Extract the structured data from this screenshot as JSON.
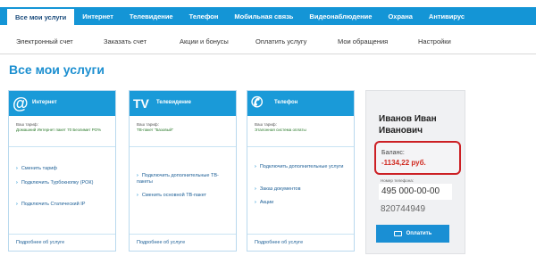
{
  "top_nav": [
    "Все мои услуги",
    "Интернет",
    "Телевидение",
    "Телефон",
    "Мобильная связь",
    "Видеонаблюдение",
    "Охрана",
    "Антивирус"
  ],
  "sub_nav": [
    "Электронный счет",
    "Заказать счет",
    "Акции и бонусы",
    "Оплатить услугу",
    "Мои обращения",
    "Настройки"
  ],
  "page_title": "Все мои услуги",
  "cards": [
    {
      "icon": "@",
      "name": "Интернет",
      "tariff_label": "Ваш тариф:",
      "tariff_value": "Домашний Интернет пакет 70 Безлимит РО%",
      "links": [
        "Сменить тариф",
        "Подключить Турбокнопку (РОК)",
        "Подключить Статический IP"
      ],
      "more": "Подробнее об услуге"
    },
    {
      "icon": "TV",
      "name": "Телевидение",
      "tariff_label": "Ваш тариф:",
      "tariff_value": "ТВ-пакет \"Базовый\"",
      "links": [
        "Подключить дополнительные ТВ-пакеты",
        "Сменить основной ТВ-пакет"
      ],
      "more": "Подробнее об услуге"
    },
    {
      "icon": "✆",
      "name": "Телефон",
      "tariff_label": "Ваш тариф:",
      "tariff_value": "Эталонная система оплаты",
      "links": [
        "Подключить дополнительные услуги",
        "Заказ документов",
        "Акции"
      ],
      "more": "Подробнее об услуге"
    }
  ],
  "profile": {
    "name_line1": "Иванов Иван",
    "name_line2": "Иванович",
    "balance_label": "Баланс:",
    "balance_value": "-1134,22 руб.",
    "phone_label": "Номер телефона:",
    "phone_value": "495 000-00-00",
    "account": "820744949",
    "pay_button": "Оплатить"
  },
  "colors": {
    "brand_blue": "#1495d6",
    "balance_red": "#d0291f",
    "highlight_border": "#cc1f24"
  }
}
